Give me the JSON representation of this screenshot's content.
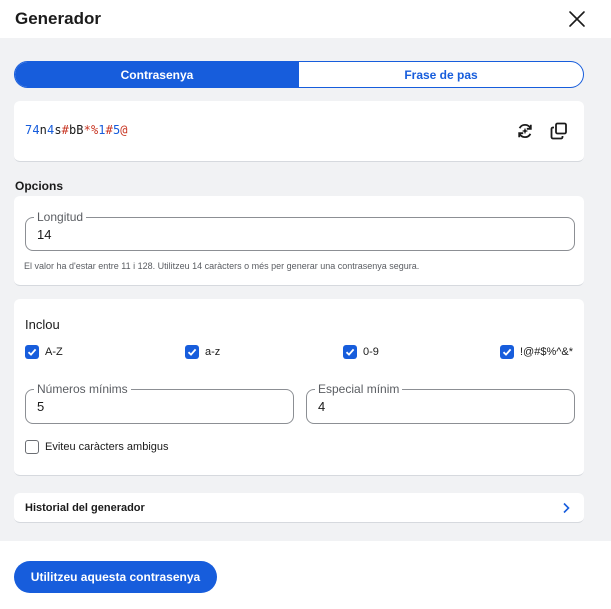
{
  "dialog": {
    "title": "Generador",
    "close_icon": "close-icon"
  },
  "tabs": [
    {
      "label": "Contrasenya",
      "active": true
    },
    {
      "label": "Frase de pas",
      "active": false
    }
  ],
  "password": {
    "segments": [
      {
        "text": "74",
        "kind": "digit"
      },
      {
        "text": "n",
        "kind": "letter"
      },
      {
        "text": "4",
        "kind": "digit"
      },
      {
        "text": "s",
        "kind": "letter"
      },
      {
        "text": "#",
        "kind": "symbol"
      },
      {
        "text": "bB",
        "kind": "letter"
      },
      {
        "text": "*%",
        "kind": "symbol"
      },
      {
        "text": "1",
        "kind": "digit"
      },
      {
        "text": "#",
        "kind": "symbol"
      },
      {
        "text": "5",
        "kind": "digit"
      },
      {
        "text": "@",
        "kind": "symbol"
      }
    ],
    "regenerate_icon": "regenerate-icon",
    "copy_icon": "copy-icon"
  },
  "options": {
    "section_title": "Opcions",
    "length": {
      "label": "Longitud",
      "value": "14",
      "hint": "El valor ha d'estar entre 11 i 128. Utilitzeu 14 caràcters o més per generar una contrasenya segura."
    },
    "include": {
      "title": "Inclou",
      "uppercase": {
        "label": "A-Z",
        "checked": true
      },
      "lowercase": {
        "label": "a-z",
        "checked": true
      },
      "numbers": {
        "label": "0-9",
        "checked": true
      },
      "special": {
        "label": "!@#$%^&*",
        "checked": true
      },
      "min_numbers": {
        "label": "Números mínims",
        "value": "5"
      },
      "min_special": {
        "label": "Especial mínim",
        "value": "4"
      },
      "avoid_ambiguous": {
        "label": "Eviteu caràcters ambigus",
        "checked": false
      }
    }
  },
  "history": {
    "label": "Historial del generador"
  },
  "footer": {
    "use_button": "Utilitzeu aquesta contrasenya"
  },
  "colors": {
    "accent": "#175ddc",
    "symbol": "#c83522",
    "background": "#f1f2f4"
  }
}
